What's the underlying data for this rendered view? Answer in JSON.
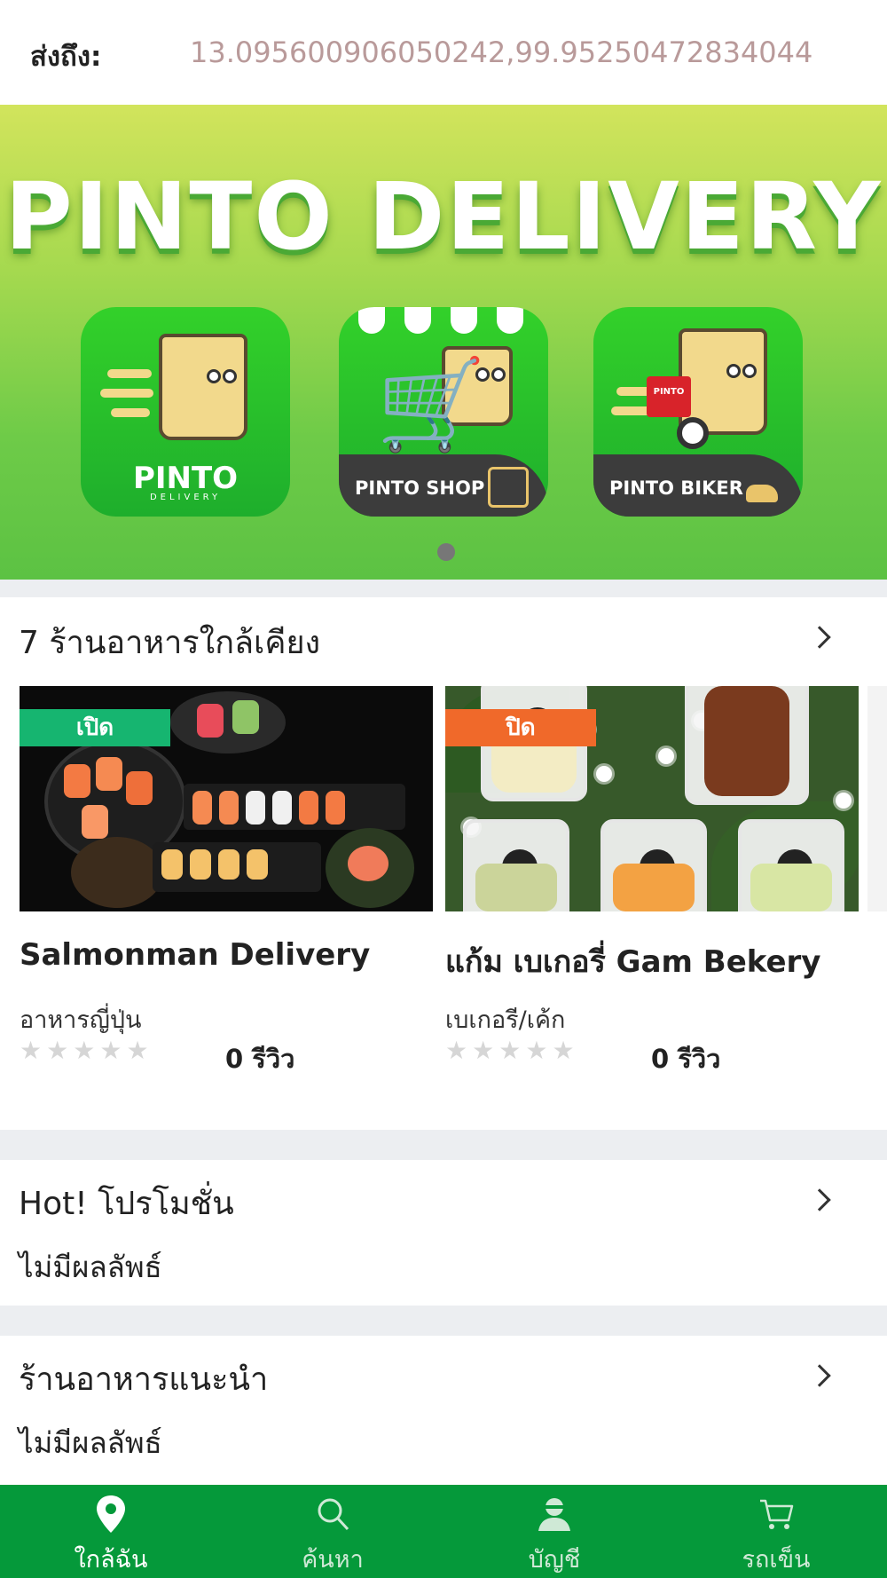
{
  "address": {
    "label": "ส่งถึง:",
    "value": "13.095600906050242,99.95250472834044"
  },
  "banner": {
    "title": "PINTO DELIVERY",
    "apps": [
      {
        "name": "PINTO",
        "sub": "DELIVERY"
      },
      {
        "name": "PINTO SHOP"
      },
      {
        "name": "PINTO BIKER"
      }
    ],
    "active_slide": 1,
    "slide_count": 1
  },
  "nearby": {
    "heading": "7 ร้านอาหารใกล้เคียง",
    "restaurants": [
      {
        "status": "เปิด",
        "name": "Salmonman Delivery",
        "category": "อาหารญี่ปุ่น",
        "rating": 0,
        "reviews": "0 รีวิว"
      },
      {
        "status": "ปิด",
        "name": "แก้ม เบเกอรี่ Gam Bekery",
        "category": "เบเกอรี/เค้ก",
        "rating": 0,
        "reviews": "0 รีวิว"
      }
    ]
  },
  "promotions": {
    "heading": "Hot! โปรโมชั่น",
    "empty": "ไม่มีผลลัพธ์"
  },
  "recommended": {
    "heading": "ร้านอาหารแนะนำ",
    "empty": "ไม่มีผลลัพธ์"
  },
  "tabbar": {
    "tabs": [
      {
        "label": "ใกล้ฉัน",
        "icon": "location-pin-icon",
        "active": true
      },
      {
        "label": "ค้นหา",
        "icon": "search-icon",
        "active": false
      },
      {
        "label": "บัญชี",
        "icon": "account-icon",
        "active": false
      },
      {
        "label": "รถเข็น",
        "icon": "cart-icon",
        "active": false
      }
    ]
  },
  "colors": {
    "brand_green": "#05993a",
    "open": "#16b570",
    "closed": "#f0692a",
    "address_value": "#b99a9a"
  }
}
